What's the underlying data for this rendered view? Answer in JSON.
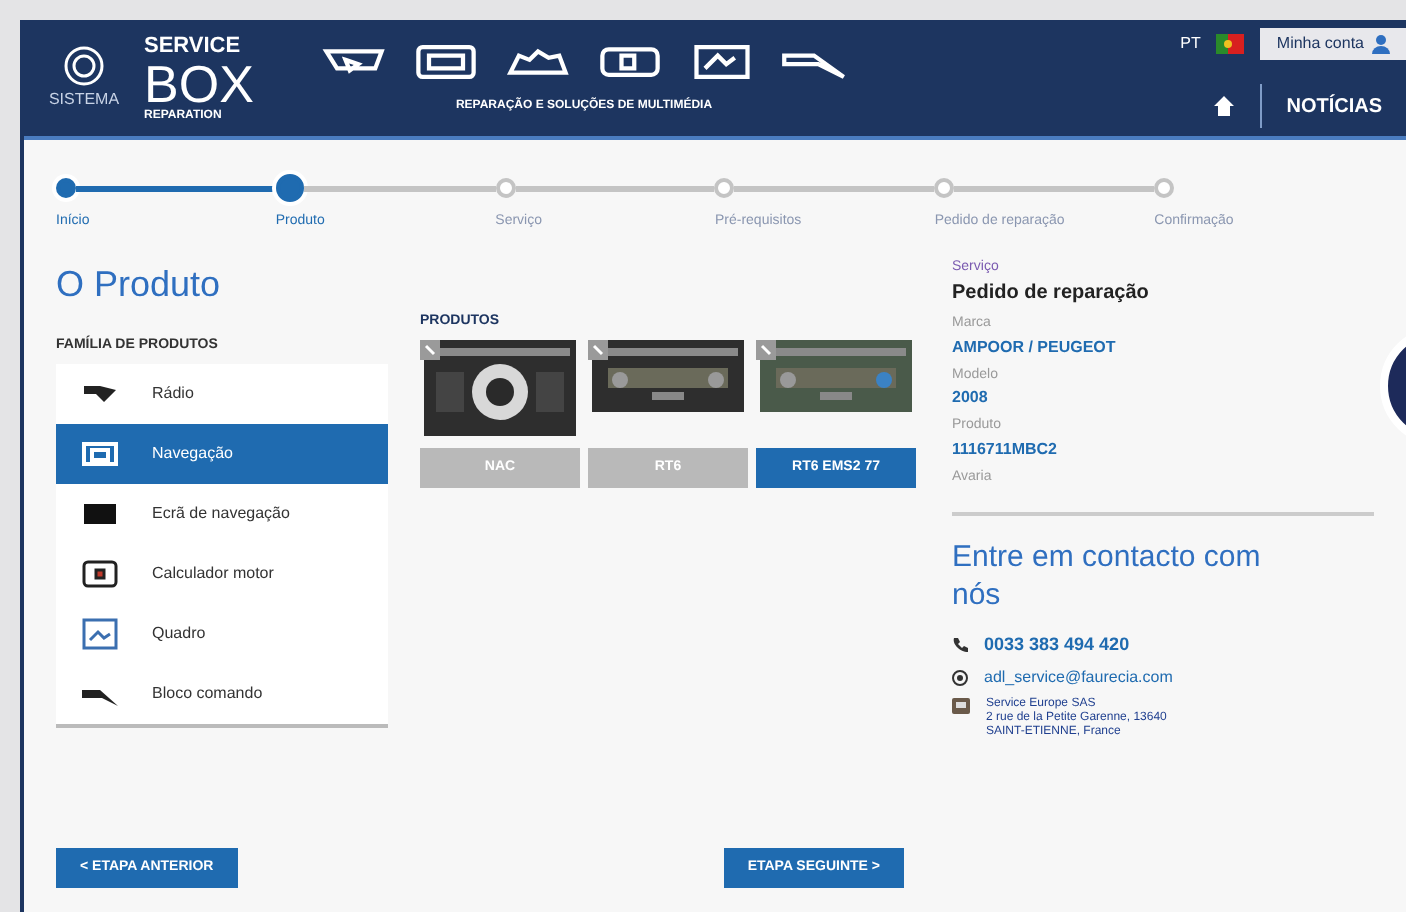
{
  "header": {
    "logo_caption": "SISTEMA",
    "brand_top": "SERVICE",
    "brand_main": "BOX",
    "brand_sub": "REPARATION",
    "subtitle": "REPARAÇÃO E SOLUÇÕES DE MULTIMÉDIA",
    "language": "PT",
    "account": "Minha conta",
    "news": "NOTÍCIAS"
  },
  "steps": [
    {
      "label": "Início",
      "completed": true,
      "selected": false
    },
    {
      "label": "Produto",
      "completed": true,
      "selected": true
    },
    {
      "label": "Serviço",
      "completed": false,
      "selected": false
    },
    {
      "label": "Pré-requisitos",
      "completed": false,
      "selected": false
    },
    {
      "label": "Pedido de reparação",
      "completed": false,
      "selected": false
    },
    {
      "label": "Confirmação",
      "completed": false,
      "selected": false
    }
  ],
  "title": "O Produto",
  "families": {
    "heading": "FAMÍLIA DE PRODUTOS",
    "items": [
      {
        "label": "Rádio",
        "selected": false
      },
      {
        "label": "Navegação",
        "selected": true
      },
      {
        "label": "Ecrã de navegação",
        "selected": false
      },
      {
        "label": "Calculador motor",
        "selected": false
      },
      {
        "label": "Quadro",
        "selected": false
      },
      {
        "label": "Bloco comando",
        "selected": false
      }
    ]
  },
  "products": {
    "heading": "PRODUTOS",
    "items": [
      {
        "label": "NAC",
        "selected": false
      },
      {
        "label": "RT6",
        "selected": false
      },
      {
        "label": "RT6 EMS2 77",
        "selected": true
      }
    ]
  },
  "summary": {
    "heading": "Serviço",
    "value": "Pedido de reparação",
    "fields": [
      {
        "label": "Marca",
        "value": "AMPOOR / PEUGEOT"
      },
      {
        "label": "Modelo",
        "value": "2008"
      },
      {
        "label": "Produto",
        "value": "1116711MBC2"
      }
    ],
    "last_label": "Avaria"
  },
  "contact": {
    "title": "Entre em contacto com nós",
    "phone": "0033 383 494 420",
    "email": "adl_service@faurecia.com",
    "address": [
      "Service Europe SAS",
      "2 rue de la Petite Garenne, 13640",
      "SAINT-ETIENNE, France"
    ]
  },
  "buttons": {
    "back": "< ETAPA ANTERIOR",
    "next": "ETAPA SEGUINTE >"
  }
}
